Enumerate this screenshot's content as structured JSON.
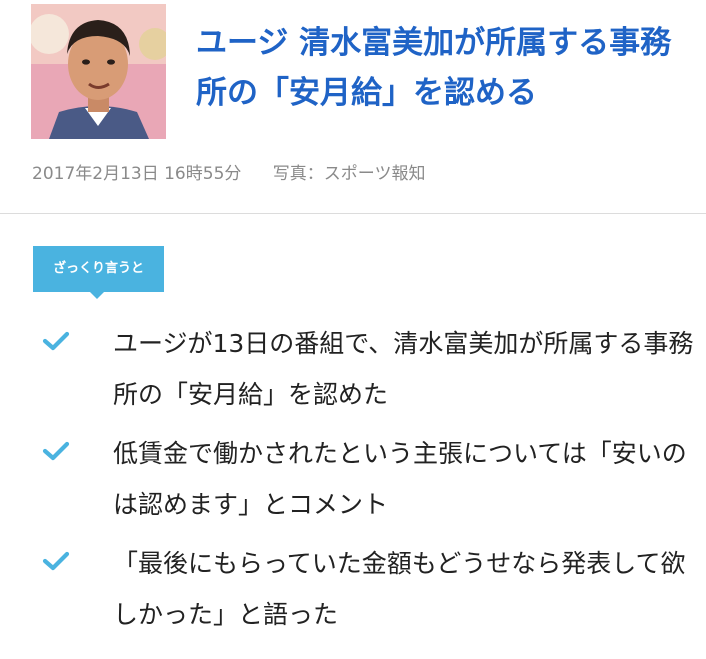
{
  "article": {
    "headline": "ユージ 清水富美加が所属する事務所の「安月給」を認める",
    "date": "2017年2月13日 16時55分",
    "photo_credit": "写真：スポーツ報知",
    "thumbnail_alt": "ユージ"
  },
  "summary": {
    "badge_label": "ざっくり言うと",
    "items": [
      {
        "text": "ユージが13日の番組で、清水富美加が所属する事務所の「安月給」を認めた"
      },
      {
        "text": "低賃金で働かされたという主張については「安いのは認めます」とコメント"
      },
      {
        "text": "「最後にもらっていた金額もどうせなら発表して欲しかった」と語った"
      }
    ]
  },
  "colors": {
    "headline": "#1f63c6",
    "accent": "#4ab3e0",
    "meta_text": "#8a8a8a",
    "body_text": "#222222"
  },
  "icons": {
    "list_marker": "checkmark-icon"
  }
}
